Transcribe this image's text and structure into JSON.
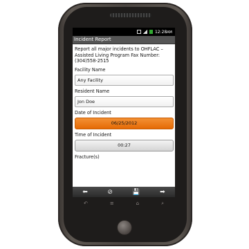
{
  "status": {
    "time": "12:28",
    "ampm": "AM"
  },
  "app": {
    "title": "Incident Report"
  },
  "intro": "Report all major incidents to OHFLAC – Assisted Living Program  Fax Number: (304)558-2515",
  "form": {
    "facility_label": "Facility Name",
    "facility_value": "Any Facility",
    "resident_label": "Resident Name",
    "resident_value": "Jon Doe",
    "date_label": "Date of Incident",
    "date_value": "06/25/2012",
    "time_label": "Time of Incident",
    "time_value": "00:27",
    "fracture_label": "Fracture(s)"
  },
  "toolbar_icons": [
    "arrow-left-icon",
    "cancel-icon",
    "save-icon",
    "arrow-right-icon"
  ],
  "softkey_icons": [
    "back-icon",
    "menu-icon",
    "home-icon",
    "search-icon"
  ],
  "colors": {
    "accent_orange": "#e56a05",
    "title_bar": "#555555",
    "status_bar": "#000000"
  }
}
